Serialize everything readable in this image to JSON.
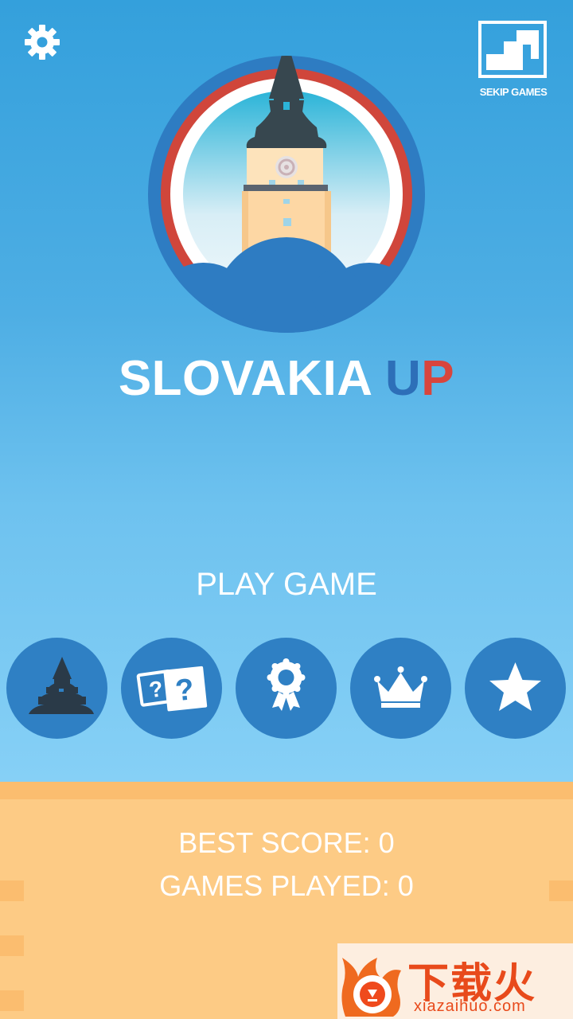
{
  "app": {
    "title_main": "SLOVAKIA ",
    "title_u": "U",
    "title_p": "P",
    "brand": "SEKIP GAMES"
  },
  "menu": {
    "play_label": "PLAY GAME",
    "buttons": [
      {
        "name": "tower-button",
        "icon": "tower-icon"
      },
      {
        "name": "quiz-button",
        "icon": "question-cards-icon"
      },
      {
        "name": "achievements-button",
        "icon": "award-ribbon-icon"
      },
      {
        "name": "leaderboard-button",
        "icon": "crown-icon"
      },
      {
        "name": "rate-button",
        "icon": "star-icon"
      }
    ]
  },
  "stats": {
    "best_score": "BEST SCORE: 0",
    "games_played": "GAMES PLAYED: 0"
  },
  "watermark": {
    "cn": "下载火",
    "en": "xiazaihuo.com"
  },
  "colors": {
    "sky": "#34a0dc",
    "button": "#2f80c4",
    "accent_blue": "#2d6fb8",
    "accent_red": "#d8453d",
    "ground": "#fdcb85"
  }
}
